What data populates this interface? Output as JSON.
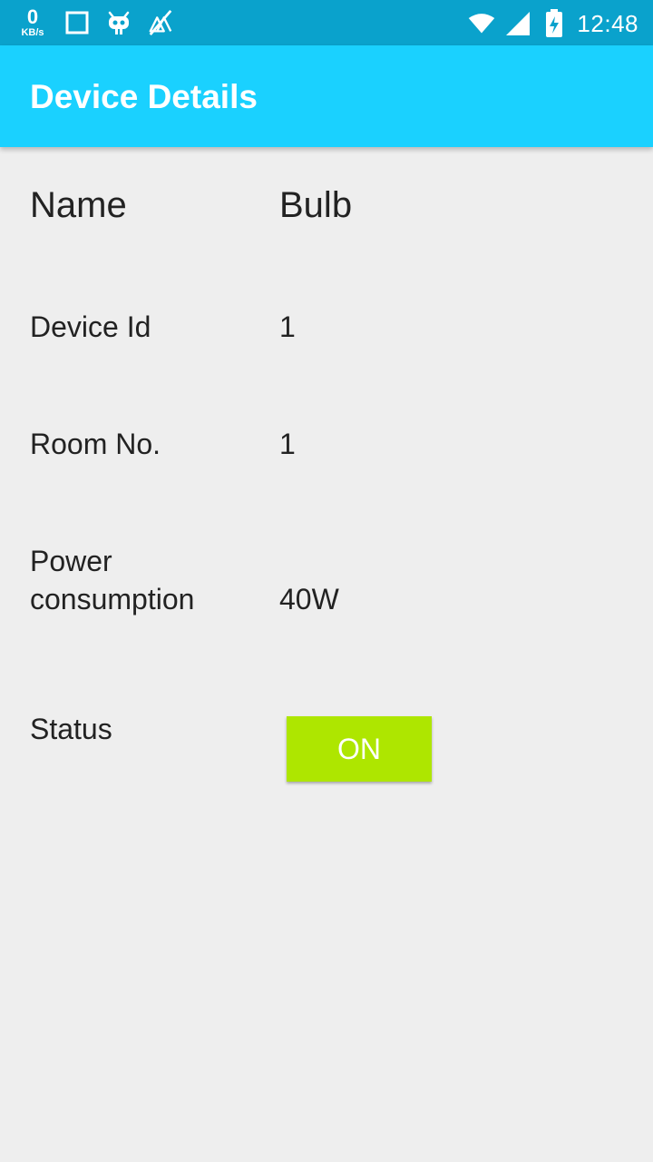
{
  "status_bar": {
    "net_speed_value": "0",
    "net_speed_unit": "KB/s",
    "time": "12:48",
    "icons": [
      "square-icon",
      "robot-icon",
      "no-location-icon",
      "wifi-icon",
      "signal-icon",
      "battery-charging-icon"
    ]
  },
  "app_bar": {
    "title": "Device Details"
  },
  "details": {
    "name": {
      "label": "Name",
      "value": "Bulb"
    },
    "device_id": {
      "label": "Device Id",
      "value": "1"
    },
    "room_no": {
      "label": "Room No.",
      "value": "1"
    },
    "power": {
      "label_line1": "Power",
      "label_line2": "consumption",
      "value": "40W"
    },
    "status": {
      "label": "Status",
      "button_label": "ON"
    }
  },
  "colors": {
    "status_bar": "#0aa2cc",
    "app_bar": "#1ad1ff",
    "background": "#eeeeee",
    "button": "#aee600"
  }
}
